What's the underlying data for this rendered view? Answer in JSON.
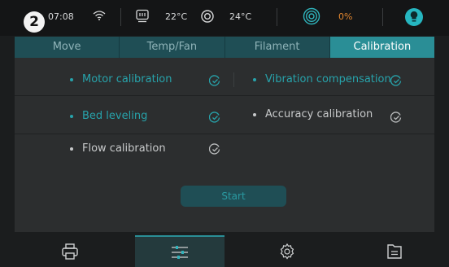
{
  "status_bar": {
    "badge": "2",
    "time": "07:08",
    "icons": [
      "wifi-icon",
      "bed-heater-icon",
      "nozzle-icon",
      "fan-icon",
      "light-bulb-icon"
    ],
    "bed_temp": "22°C",
    "nozzle_temp": "24°C",
    "fan_speed": "0%",
    "colors": {
      "accent": "#2a8e96",
      "fan_value": "#e2862f",
      "bulb": "#26b6c0"
    }
  },
  "tabs": [
    {
      "label": "Move",
      "active": false
    },
    {
      "label": "Temp/Fan",
      "active": false
    },
    {
      "label": "Filament",
      "active": false
    },
    {
      "label": "Calibration",
      "active": true
    }
  ],
  "calibration": {
    "items": [
      {
        "label": "Motor calibration",
        "selected": true
      },
      {
        "label": "Vibration compensation",
        "selected": true
      },
      {
        "label": "Bed leveling",
        "selected": true
      },
      {
        "label": "Accuracy calibration",
        "selected": false
      },
      {
        "label": "Flow calibration",
        "selected": false
      }
    ],
    "start_label": "Start"
  },
  "bottom_nav": [
    {
      "icon": "printer-icon",
      "active": false
    },
    {
      "icon": "sliders-icon",
      "active": true
    },
    {
      "icon": "gear-icon",
      "active": false
    },
    {
      "icon": "file-icon",
      "active": false
    }
  ]
}
